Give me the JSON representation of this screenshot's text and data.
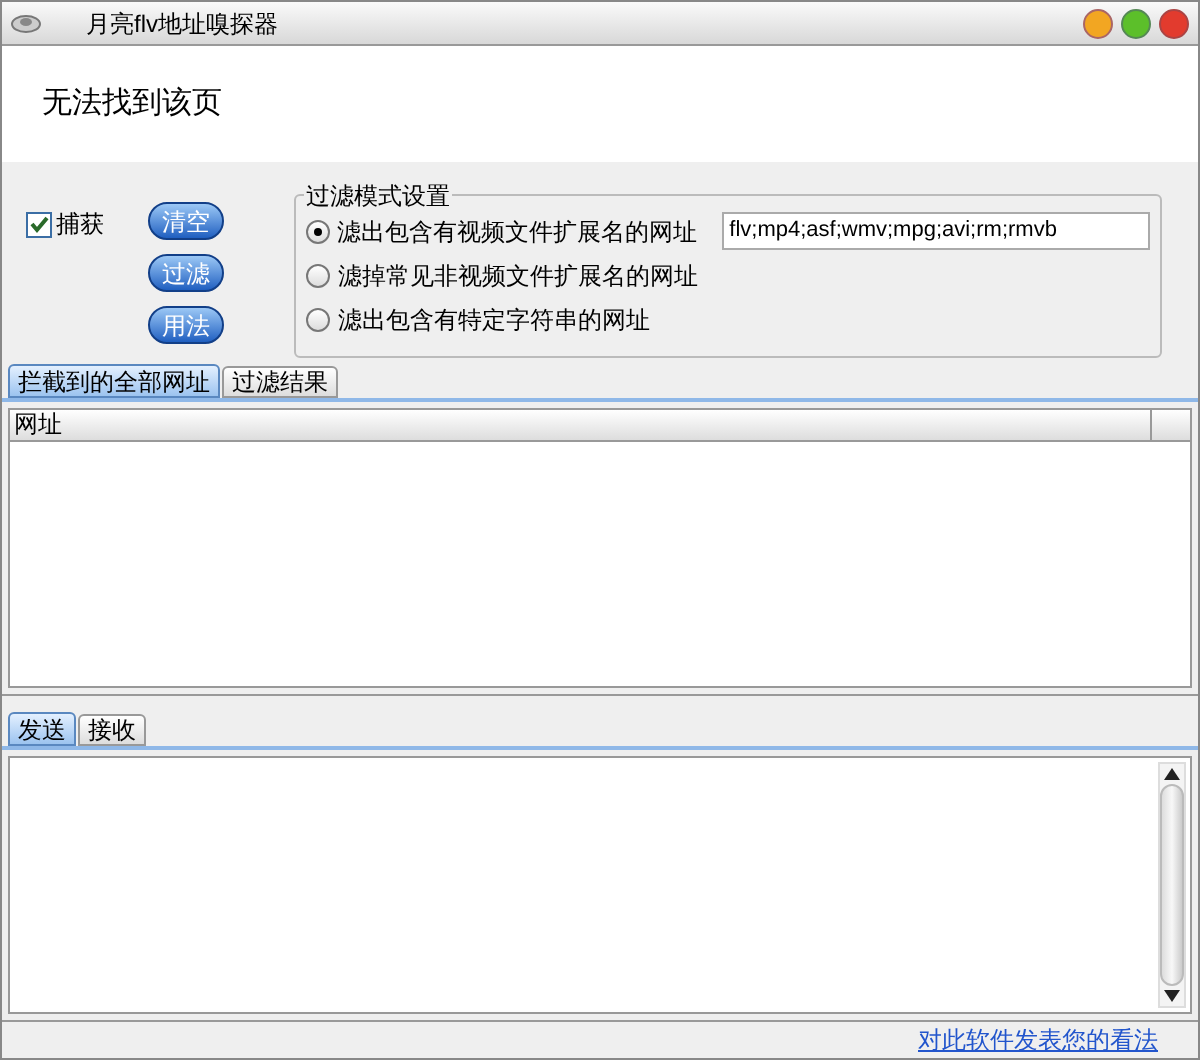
{
  "window": {
    "title": "月亮flv地址嗅探器"
  },
  "browser": {
    "message": "无法找到该页"
  },
  "capture": {
    "label": "捕获",
    "checked": true
  },
  "buttons": [
    "清空",
    "过滤",
    "用法"
  ],
  "filter": {
    "title": "过滤模式设置",
    "extensions": "flv;mp4;asf;wmv;mpg;avi;rm;rmvb",
    "options": [
      {
        "label": "滤出包含有视频文件扩展名的网址",
        "selected": true
      },
      {
        "label": "滤掉常见非视频文件扩展名的网址",
        "selected": false
      },
      {
        "label": "滤出包含有特定字符串的网址",
        "selected": false
      }
    ]
  },
  "top_tabs": [
    {
      "label": "拦截到的全部网址",
      "selected": true
    },
    {
      "label": "过滤结果",
      "selected": false
    }
  ],
  "table": {
    "columns": [
      "网址"
    ]
  },
  "bottom_tabs": [
    {
      "label": "发送",
      "selected": true
    },
    {
      "label": "接收",
      "selected": false
    }
  ],
  "feedback_link": "对此软件发表您的看法"
}
